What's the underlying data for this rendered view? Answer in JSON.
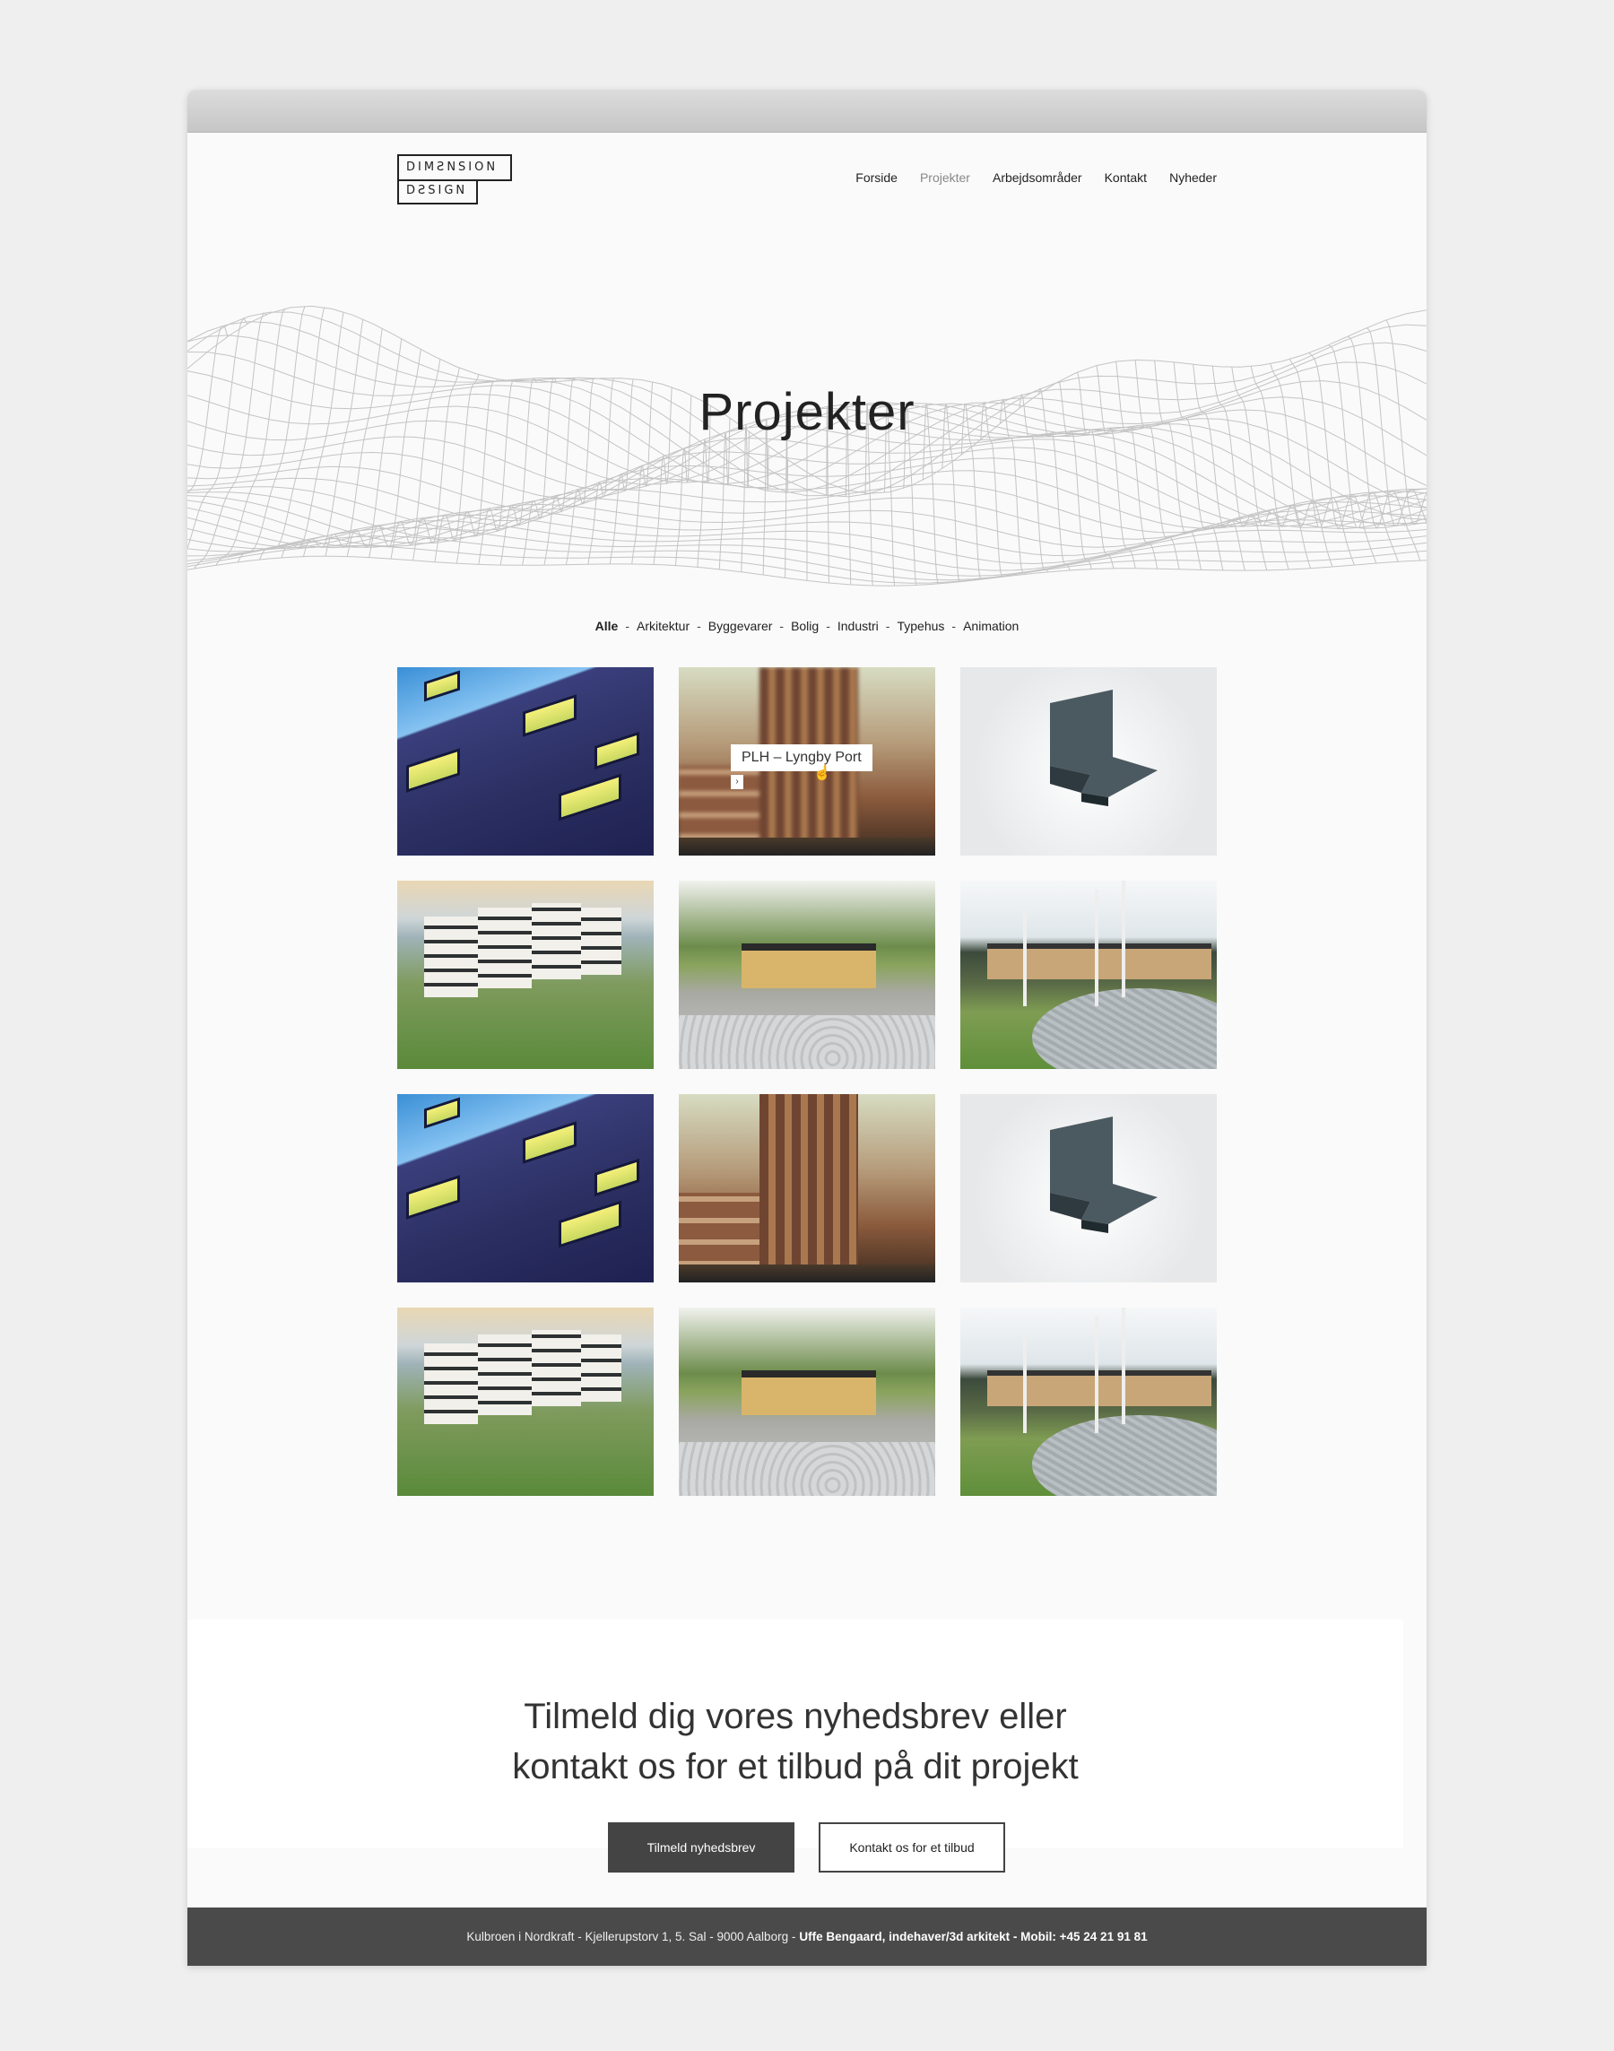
{
  "header": {
    "logo_line1": "DIMƧNSION",
    "logo_line2": "DƧSIGN",
    "nav": [
      {
        "label": "Forside",
        "active": false
      },
      {
        "label": "Projekter",
        "active": true
      },
      {
        "label": "Arbejdsområder",
        "active": false
      },
      {
        "label": "Kontakt",
        "active": false
      },
      {
        "label": "Nyheder",
        "active": false
      }
    ]
  },
  "hero": {
    "title": "Projekter"
  },
  "filters": {
    "items": [
      "Alle",
      "Arkitektur",
      "Byggevarer",
      "Bolig",
      "Industri",
      "Typehus",
      "Animation"
    ],
    "active": "Alle",
    "separator": "-"
  },
  "projects": {
    "hover_label": "PLH – Lyngby Port",
    "hover_arrow": "›",
    "tiles": [
      "facade",
      "tower-hover",
      "product",
      "housing",
      "plaza",
      "park",
      "facade",
      "tower",
      "product",
      "housing",
      "plaza",
      "park"
    ]
  },
  "cta": {
    "line1": "Tilmeld dig vores nyhedsbrev eller",
    "line2": "kontakt os for et tilbud på dit projekt",
    "primary_button": "Tilmeld nyhedsbrev",
    "secondary_button": "Kontakt os for et tilbud"
  },
  "footer": {
    "address": "Kulbroen i Nordkraft  - Kjellerupstorv 1, 5. Sal - 9000 Aalborg -",
    "contact": "Uffe Bengaard, indehaver/3d arkitekt - Mobil: +45 24 21 91 81"
  },
  "colors": {
    "background": "#efefef",
    "page": "#fafafa",
    "dark_button": "#444444",
    "footer": "#4a4a4a"
  }
}
